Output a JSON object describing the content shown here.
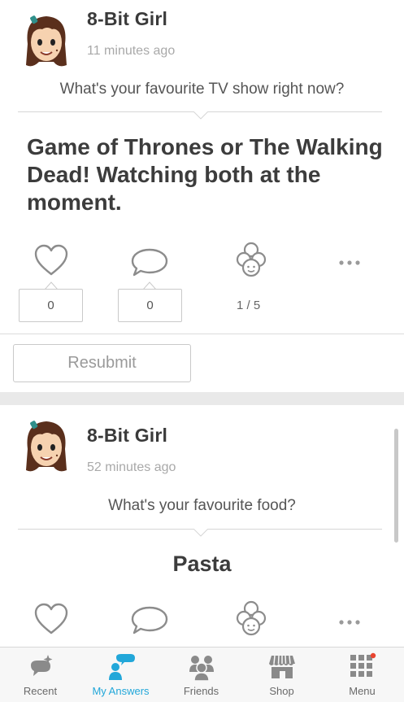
{
  "posts": [
    {
      "username": "8-Bit Girl",
      "timestamp": "11 minutes ago",
      "question": "What's your favourite TV show right now?",
      "answer": "Game of Thrones or The Walking Dead! Watching both at the moment.",
      "likes": "0",
      "comments": "0",
      "ratio": "1 / 5",
      "resubmit_label": "Resubmit"
    },
    {
      "username": "8-Bit Girl",
      "timestamp": "52 minutes ago",
      "question": "What's your favourite food?",
      "answer": "Pasta"
    }
  ],
  "nav": {
    "items": [
      {
        "label": "Recent",
        "icon": "recent-icon"
      },
      {
        "label": "My Answers",
        "icon": "my-answers-icon"
      },
      {
        "label": "Friends",
        "icon": "friends-icon"
      },
      {
        "label": "Shop",
        "icon": "shop-icon"
      },
      {
        "label": "Menu",
        "icon": "menu-grid-icon"
      }
    ],
    "active": "My Answers"
  },
  "colors": {
    "accent": "#22a7d9",
    "notification_dot": "#e8442f",
    "avatar_hair": "#5a2f1c",
    "avatar_skin": "#f6d2b0",
    "hair_clip": "#2f8f8a"
  }
}
